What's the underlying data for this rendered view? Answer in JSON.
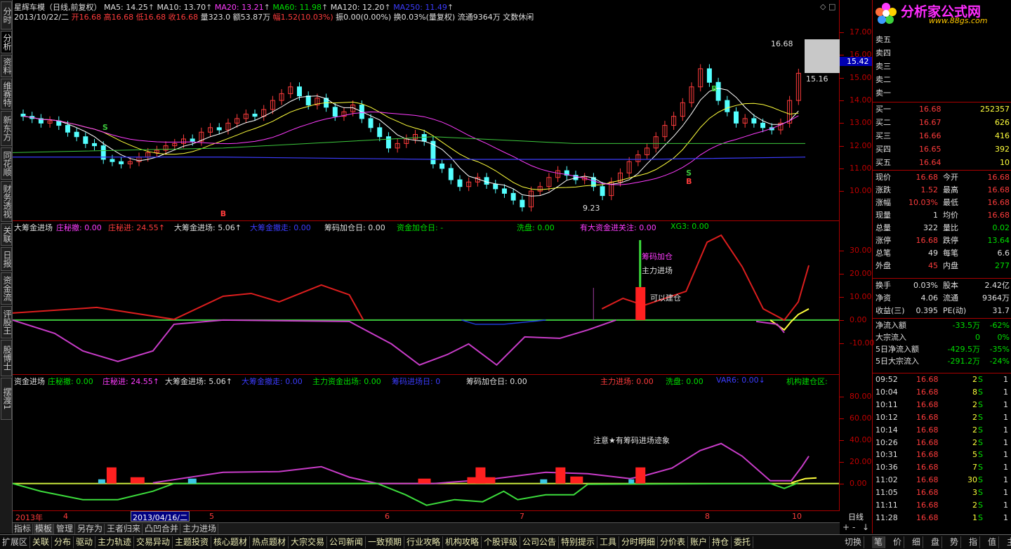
{
  "left_tabs": [
    "分时",
    "分析",
    "资料",
    "维赛特",
    "新东方",
    "同花顺",
    "财务透视",
    "关联",
    "日报",
    "资金流",
    "评股王",
    "股博士",
    "摆渡1"
  ],
  "header": {
    "title": "星辉车模（日线,前复权）",
    "ma5": "MA5: 14.25",
    "ma10": "MA10: 13.70",
    "ma20": "MA20: 13.21",
    "ma60": "MA60: 11.98",
    "ma120": "MA120: 12.20",
    "ma250": "MA250: 11.49",
    "line2": {
      "date": "2013/10/22/二",
      "open": "开16.68",
      "high": "高16.68",
      "low": "低16.68",
      "close": "收16.68",
      "vol": "量323.0",
      "amt": "额53.87万",
      "fu": "幅1.52(10.03%)",
      "zhen": "振0.00(0.00%)",
      "huan": "换0.03%(量复权)",
      "liutong": "流通9364万",
      "event": "文数休闲"
    }
  },
  "price_axis": [
    "17.00",
    "16.00",
    "15.00",
    "14.00",
    "13.00",
    "12.00",
    "11.00",
    "10.00"
  ],
  "price_labels": {
    "high_mark": "16.68",
    "box_value": "15.42",
    "low_mark": "15.16",
    "min_mark": "9.23"
  },
  "candle_markers": [
    "S",
    "B",
    "S",
    "B",
    "B"
  ],
  "ind1": {
    "labels": [
      {
        "t": "大筹金进场",
        "c": "white"
      },
      {
        "t": "庄秘撤: 0.00",
        "c": "mag"
      },
      {
        "t": "庄秘进: 24.55↑",
        "c": "red"
      },
      {
        "t": "大筹金进场: 5.06↑",
        "c": "white"
      },
      {
        "t": "大筹金撤走: 0.00",
        "c": "blue"
      },
      {
        "t": "筹码加仓日: 0.00",
        "c": "white"
      },
      {
        "t": "资金加仓日: -",
        "c": "green"
      },
      {
        "t": "洗盘: 0.00",
        "c": "green"
      },
      {
        "t": "有大资金进关注: 0.00",
        "c": "mag"
      },
      {
        "t": "XG3: 0.00",
        "c": "green"
      }
    ],
    "axis": [
      "30.00",
      "20.00",
      "10.00",
      "0.00",
      "-10.00"
    ],
    "notes": [
      "筹码加仓",
      "主力进场",
      "可以建仓"
    ]
  },
  "ind2": {
    "labels": [
      {
        "t": "资金进场",
        "c": "white"
      },
      {
        "t": "庄秘撤: 0.00",
        "c": "green"
      },
      {
        "t": "庄秘进: 24.55↑",
        "c": "mag"
      },
      {
        "t": "大筹金进场: 5.06↑",
        "c": "white"
      },
      {
        "t": "大筹金撤走: 0.00",
        "c": "blue"
      },
      {
        "t": "主力资金出场: 0.00",
        "c": "green"
      },
      {
        "t": "筹码进场日: 0",
        "c": "blue"
      },
      {
        "t": "筹码加仓日: 0.00",
        "c": "white"
      },
      {
        "t": "主力进场: 0.00",
        "c": "red"
      },
      {
        "t": "洗盘: 0.00",
        "c": "green"
      },
      {
        "t": "VAR6: 0.00↓",
        "c": "blue"
      },
      {
        "t": "机构建仓区:",
        "c": "green"
      }
    ],
    "axis": [
      "80.00",
      "60.00",
      "40.00",
      "20.00",
      "0.00"
    ],
    "note": "注意★有筹码进场迹象"
  },
  "time_axis": {
    "year": "2013年",
    "m4": "4",
    "sel": "2013/04/16/二",
    "m5": "5",
    "m6": "6",
    "m7": "7",
    "m8": "8",
    "m10": "10",
    "period": "日线"
  },
  "toolbar2": [
    "指标",
    "模板",
    "管理",
    "另存为",
    "王者归来",
    "凸凹合并",
    "主力进场"
  ],
  "bottom": [
    "扩展区",
    "关联",
    "分布",
    "驱动",
    "主力轨迹",
    "交易异动",
    "主题投资",
    "核心题材",
    "热点题材",
    "大宗交易",
    "公司新闻",
    "一致预期",
    "行业攻略",
    "机构攻略",
    "个股评级",
    "公司公告",
    "特别提示",
    "工具",
    "分时明细",
    "分价表",
    "账户",
    "持仓",
    "委托"
  ],
  "bottom_right": [
    "切换",
    "笔",
    "价",
    "细",
    "盘",
    "势",
    "指",
    "值",
    "主"
  ],
  "logo": {
    "name": "分析家公式网",
    "url": "www.88gs.com"
  },
  "sells": [
    {
      "l": "卖五",
      "p": "",
      "v": ""
    },
    {
      "l": "卖四",
      "p": "",
      "v": ""
    },
    {
      "l": "卖三",
      "p": "",
      "v": ""
    },
    {
      "l": "卖二",
      "p": "",
      "v": ""
    },
    {
      "l": "卖一",
      "p": "",
      "v": ""
    }
  ],
  "buys": [
    {
      "l": "买一",
      "p": "16.68",
      "v": "252357"
    },
    {
      "l": "买二",
      "p": "16.67",
      "v": "626"
    },
    {
      "l": "买三",
      "p": "16.66",
      "v": "416"
    },
    {
      "l": "买四",
      "p": "16.65",
      "v": "392"
    },
    {
      "l": "买五",
      "p": "16.64",
      "v": "10"
    }
  ],
  "stats": [
    {
      "a": "现价",
      "b": "16.68",
      "c": "今开",
      "d": "16.68",
      "bc": "red",
      "dc": "red"
    },
    {
      "a": "涨跌",
      "b": "1.52",
      "c": "最高",
      "d": "16.68",
      "bc": "red",
      "dc": "red"
    },
    {
      "a": "涨幅",
      "b": "10.03%",
      "c": "最低",
      "d": "16.68",
      "bc": "red",
      "dc": "red"
    },
    {
      "a": "现量",
      "b": "1",
      "c": "均价",
      "d": "16.68",
      "bc": "white",
      "dc": "red"
    },
    {
      "a": "总量",
      "b": "322",
      "c": "量比",
      "d": "0.02",
      "bc": "white",
      "dc": "green"
    },
    {
      "a": "涨停",
      "b": "16.68",
      "c": "跌停",
      "d": "13.64",
      "bc": "red",
      "dc": "green"
    },
    {
      "a": "总笔",
      "b": "49",
      "c": "每笔",
      "d": "6.6",
      "bc": "white",
      "dc": "white"
    },
    {
      "a": "外盘",
      "b": "45",
      "c": "内盘",
      "d": "277",
      "bc": "red",
      "dc": "green"
    }
  ],
  "stats2": [
    {
      "a": "换手",
      "b": "0.03%",
      "c": "股本",
      "d": "2.42亿"
    },
    {
      "a": "净资",
      "b": "4.06",
      "c": "流通",
      "d": "9364万"
    },
    {
      "a": "收益(三)",
      "b": "0.395",
      "c": "PE(动)",
      "d": "31.7"
    }
  ],
  "flows": [
    {
      "a": "净流入额",
      "b": "-33.5万",
      "c": "-62%"
    },
    {
      "a": "大宗流入",
      "b": "0",
      "c": "0%"
    },
    {
      "a": "5日净流入额",
      "b": "-429.5万",
      "c": "-35%"
    },
    {
      "a": "5日大宗流入",
      "b": "-291.2万",
      "c": "-24%"
    }
  ],
  "ticks": [
    {
      "t": "09:52",
      "p": "16.68",
      "v": "2",
      "s": "S",
      "n": "1"
    },
    {
      "t": "10:04",
      "p": "16.68",
      "v": "8",
      "s": "S",
      "n": "1"
    },
    {
      "t": "10:11",
      "p": "16.68",
      "v": "2",
      "s": "S",
      "n": "1"
    },
    {
      "t": "10:12",
      "p": "16.68",
      "v": "2",
      "s": "S",
      "n": "1"
    },
    {
      "t": "10:14",
      "p": "16.68",
      "v": "2",
      "s": "S",
      "n": "1"
    },
    {
      "t": "10:26",
      "p": "16.68",
      "v": "2",
      "s": "S",
      "n": "1"
    },
    {
      "t": "10:31",
      "p": "16.68",
      "v": "5",
      "s": "S",
      "n": "1"
    },
    {
      "t": "10:36",
      "p": "16.68",
      "v": "7",
      "s": "S",
      "n": "1"
    },
    {
      "t": "11:02",
      "p": "16.68",
      "v": "30",
      "s": "S",
      "n": "1"
    },
    {
      "t": "11:05",
      "p": "16.68",
      "v": "3",
      "s": "S",
      "n": "1"
    },
    {
      "t": "11:11",
      "p": "16.68",
      "v": "2",
      "s": "S",
      "n": "1"
    },
    {
      "t": "11:28",
      "p": "16.68",
      "v": "1",
      "s": "S",
      "n": "1"
    }
  ]
}
